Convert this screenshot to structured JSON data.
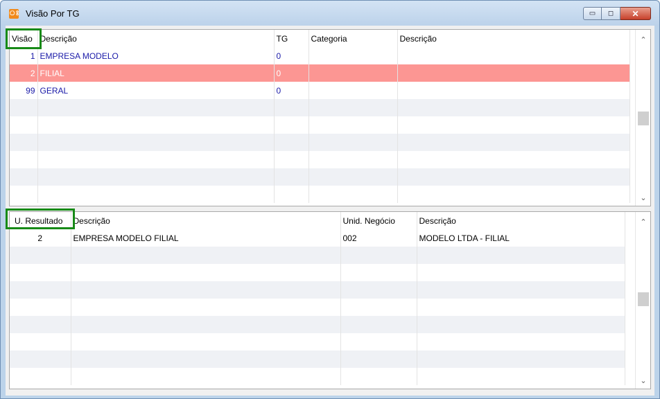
{
  "window": {
    "title": "Visão Por TG",
    "app_icon_glyph": "ঃ",
    "minimize_glyph": "▭",
    "maximize_glyph": "◻",
    "close_glyph": "✕"
  },
  "top_grid": {
    "columns": [
      "Visão",
      "Descrição",
      "TG",
      "Categoria",
      "Descrição"
    ],
    "rows": [
      [
        "1",
        "EMPRESA MODELO",
        "0",
        "",
        ""
      ],
      [
        "2",
        "FILIAL",
        "0",
        "",
        ""
      ],
      [
        "99",
        "GERAL",
        "0",
        "",
        ""
      ]
    ],
    "selected_row": 1,
    "scroll_up": "⌃",
    "scroll_down": "⌄"
  },
  "bottom_grid": {
    "columns": [
      "U. Resultado",
      "Descrição",
      "Unid. Negócio",
      "Descrição"
    ],
    "rows": [
      [
        "2",
        "EMPRESA MODELO FILIAL",
        "002",
        "MODELO LTDA - FILIAL"
      ]
    ],
    "scroll_up": "⌃",
    "scroll_down": "⌄"
  },
  "colors": {
    "selected_row": "#fc9693",
    "highlight_box": "#178a17",
    "link_text": "#1a1aa8"
  }
}
